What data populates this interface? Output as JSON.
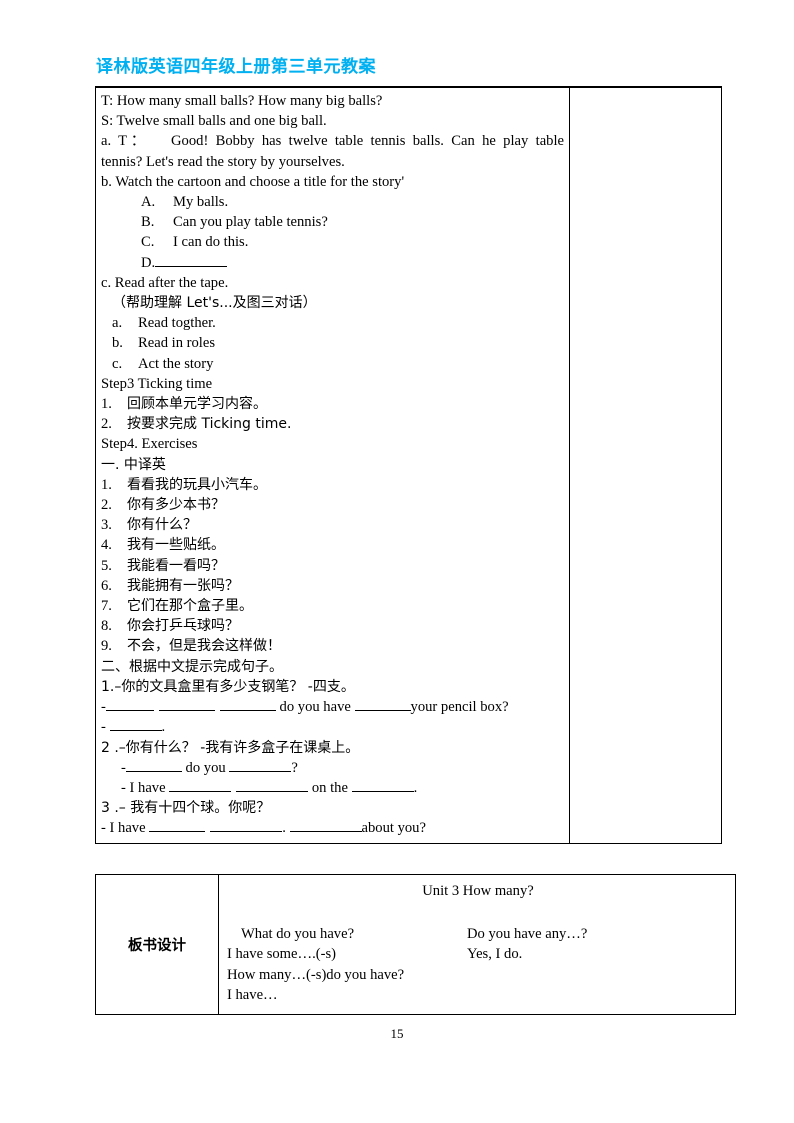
{
  "document": {
    "title": "译林版英语四年级上册第三单元教案",
    "title_color": "#00b0f0",
    "page_number": "15"
  },
  "lesson": {
    "dialogue": [
      "T: How many small balls? How many big balls?",
      "S: Twelve small balls and one big ball."
    ],
    "step2": {
      "item_a_marker": "a. T：",
      "item_a_text": "Good! Bobby has twelve table tennis balls. Can he play table tennis? Let's read the story by yourselves.",
      "item_a_line1": "Good! Bobby has twelve table tennis balls. Can he play table",
      "item_a_line2": "tennis? Let's read the story by yourselves.",
      "item_b": "b. Watch the cartoon and choose a title for the story'",
      "choices": [
        {
          "marker": "A.",
          "text": "My balls."
        },
        {
          "marker": "B.",
          "text": "Can you play table tennis?"
        },
        {
          "marker": "C.",
          "text": "I can do this."
        },
        {
          "marker": "D.",
          "text": ""
        }
      ],
      "item_c": "c. Read after the tape.",
      "note_cn": "（帮助理解 Let's...及图三对话）",
      "sub_items": [
        {
          "marker": "a.",
          "text": "Read togther."
        },
        {
          "marker": "b.",
          "text": "Read in roles"
        },
        {
          "marker": "c.",
          "text": "Act the story"
        }
      ]
    },
    "step3": {
      "heading": "Step3 Ticking time",
      "items": [
        {
          "marker": "1.",
          "text": "回顾本单元学习内容。"
        },
        {
          "marker": "2.",
          "text": "按要求完成 Ticking time."
        }
      ]
    },
    "step4": {
      "heading": "Step4. Exercises",
      "section1_heading": "一.        中译英",
      "section1_items": [
        {
          "marker": "1.",
          "text": "看看我的玩具小汽车。"
        },
        {
          "marker": "2.",
          "text": "你有多少本书？"
        },
        {
          "marker": "3.",
          "text": "你有什么？"
        },
        {
          "marker": "4.",
          "text": "我有一些贴纸。"
        },
        {
          "marker": "5.",
          "text": "我能看一看吗？"
        },
        {
          "marker": "6.",
          "text": "我能拥有一张吗？"
        },
        {
          "marker": "7.",
          "text": "它们在那个盒子里。"
        },
        {
          "marker": "8.",
          "text": "你会打乒乓球吗？"
        },
        {
          "marker": "9.",
          "text": "不会，但是我会这样做！"
        }
      ],
      "section2_heading": "二、根据中文提示完成句子。",
      "q1": {
        "prompt": "1.–你的文具盒里有多少支钢笔？ -四支。",
        "answer_l1_pre": "-",
        "answer_l1_mid": " do you have ",
        "answer_l1_end": "your pencil box?",
        "answer_l2": "- "
      },
      "q2": {
        "prompt": "2 .–你有什么？ -我有许多盒子在课桌上。",
        "answer_l1_pre": "-",
        "answer_l1_mid": " do you ",
        "answer_l1_end": "?",
        "answer_l2_pre": "- I have ",
        "answer_l2_mid": " on the ",
        "answer_l2_end": "."
      },
      "q3": {
        "prompt": "3 .–  我有十四个球。你呢？",
        "answer_pre": "- I have ",
        "answer_mid": ". ",
        "answer_end": "about you?"
      }
    }
  },
  "blackboard": {
    "label": "板书设计",
    "heading": "Unit 3 How many?",
    "rows": [
      {
        "left": "What do you have?",
        "right": "Do you have any…?"
      },
      {
        "left": "I have some….(-s)",
        "right": "Yes, I do."
      },
      {
        "left": "How many…(-s)do you have?",
        "right": ""
      },
      {
        "left": "I have…",
        "right": ""
      }
    ]
  }
}
